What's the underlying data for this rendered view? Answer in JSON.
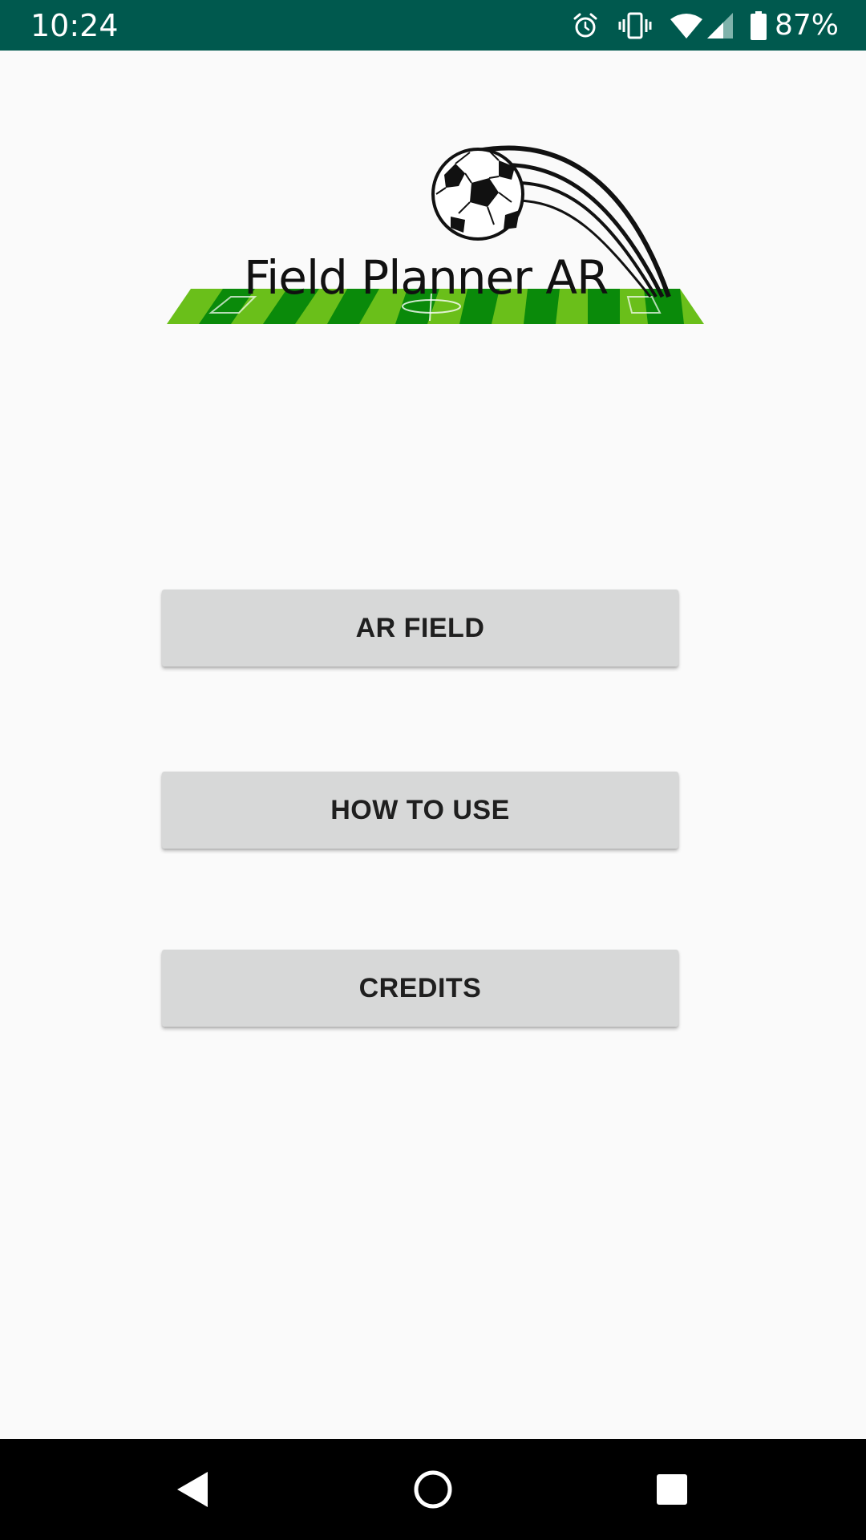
{
  "status_bar": {
    "time": "10:24",
    "battery_percent": "87%",
    "icons": [
      "alarm-icon",
      "vibrate-icon",
      "wifi-icon",
      "cell-signal-icon",
      "battery-icon"
    ],
    "background_color": "#00594e"
  },
  "logo": {
    "title": "Field Planner AR",
    "icons": [
      "soccer-ball-icon",
      "soccer-field-icon"
    ]
  },
  "menu": {
    "ar_field_label": "AR FIELD",
    "how_to_use_label": "HOW TO USE",
    "credits_label": "CREDITS"
  },
  "nav_bar": {
    "icons": [
      "back-icon",
      "home-icon",
      "recents-icon"
    ]
  },
  "colors": {
    "background": "#fafafa",
    "button": "#d7d8d8",
    "field_light": "#6abf1a",
    "field_dark": "#0a8a0a"
  }
}
